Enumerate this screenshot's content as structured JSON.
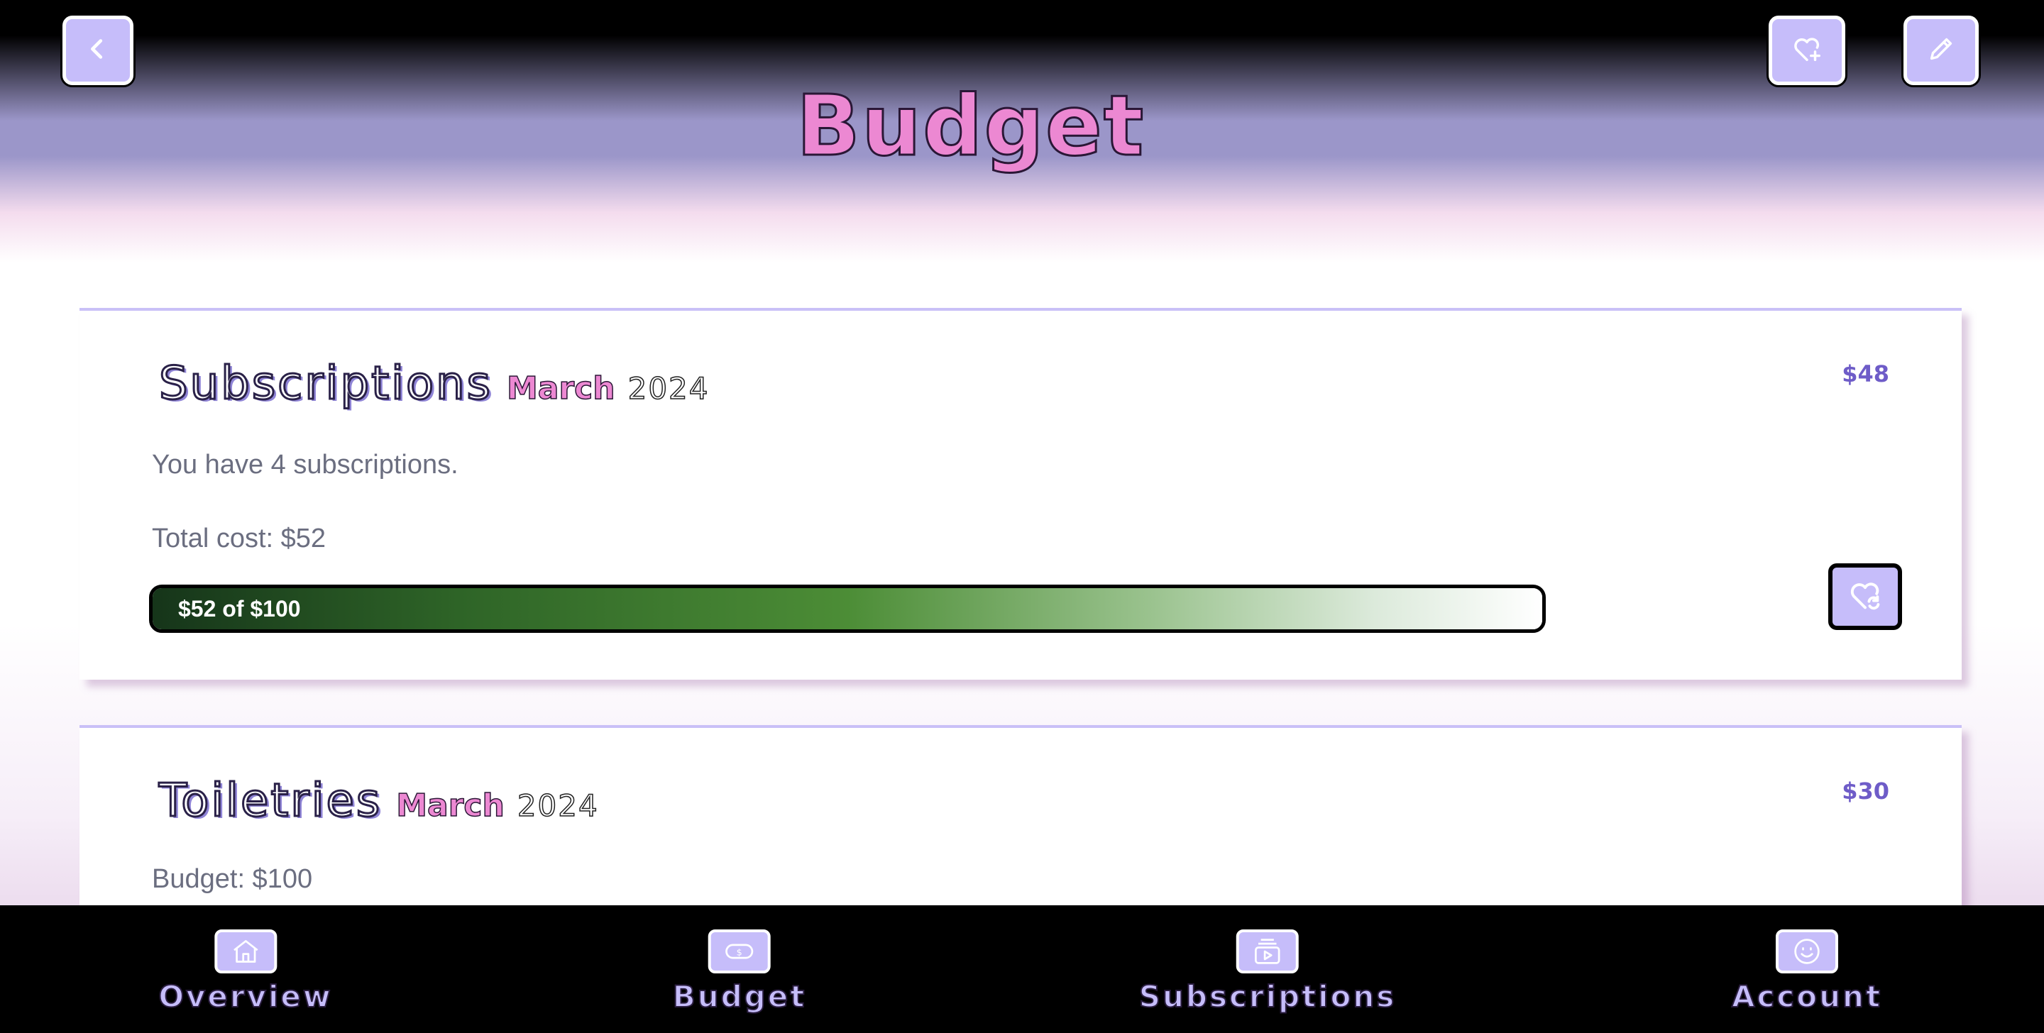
{
  "header": {
    "title": "Budget",
    "back_icon": "chevron-left-icon",
    "add_icon": "heart-plus-icon",
    "edit_icon": "pencil-icon"
  },
  "cards": [
    {
      "name": "Subscriptions",
      "month": "March",
      "year": "2024",
      "amount": "$48",
      "line1": "You have 4 subscriptions.",
      "line2": "Total cost: $52",
      "progress_label": "$52 of $100",
      "progress_fraction": 0.52,
      "action_icon": "heart-refresh-icon"
    },
    {
      "name": "Toiletries",
      "month": "March",
      "year": "2024",
      "amount": "$30",
      "line1": "Budget: $100"
    }
  ],
  "nav": {
    "items": [
      {
        "label": "Overview",
        "icon": "home-icon"
      },
      {
        "label": "Budget",
        "icon": "money-icon"
      },
      {
        "label": "Subscriptions",
        "icon": "play-stack-icon"
      },
      {
        "label": "Account",
        "icon": "smiley-icon"
      }
    ]
  },
  "colors": {
    "accent_lavender": "#c6bdfa",
    "title_pink": "#ec88d2",
    "amount_purple": "#6e5cc8",
    "progress_green": "#4c8d36"
  }
}
